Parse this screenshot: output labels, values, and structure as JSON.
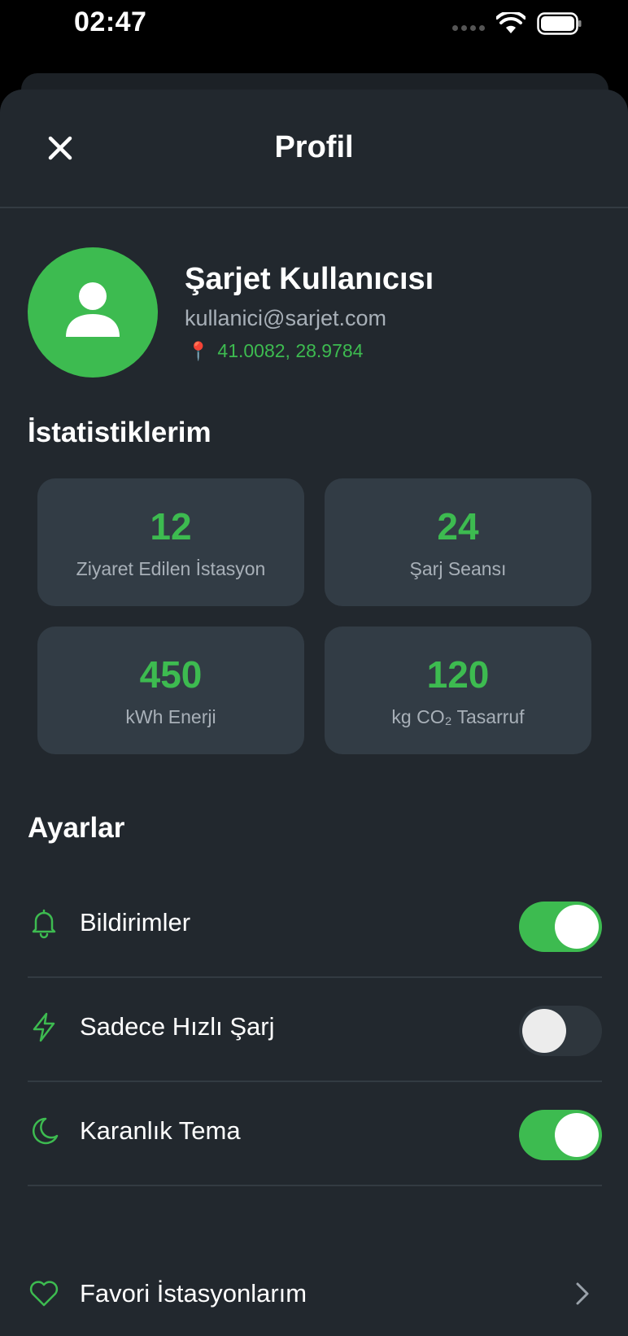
{
  "status_bar": {
    "time": "02:47"
  },
  "header": {
    "title": "Profil",
    "close_icon": "close-icon"
  },
  "profile": {
    "name": "Şarjet Kullanıcısı",
    "email": "kullanici@sarjet.com",
    "location_icon": "📍",
    "coordinates": "41.0082, 28.9784"
  },
  "stats": {
    "title": "İstatistiklerim",
    "items": [
      {
        "value": "12",
        "label": "Ziyaret Edilen İstasyon"
      },
      {
        "value": "24",
        "label": "Şarj Seansı"
      },
      {
        "value": "450",
        "label": "kWh Enerji"
      },
      {
        "value": "120",
        "label": "kg CO₂ Tasarruf"
      }
    ]
  },
  "settings": {
    "title": "Ayarlar",
    "items": [
      {
        "label": "Bildirimler",
        "icon": "bell-icon",
        "enabled": true
      },
      {
        "label": "Sadece Hızlı Şarj",
        "icon": "lightning-icon",
        "enabled": false
      },
      {
        "label": "Karanlık Tema",
        "icon": "moon-icon",
        "enabled": true
      }
    ],
    "favorites": {
      "label": "Favori İstasyonlarım",
      "icon": "heart-icon"
    }
  },
  "colors": {
    "accent": "#3dbb50",
    "background": "#22282e",
    "card": "#323c45"
  }
}
